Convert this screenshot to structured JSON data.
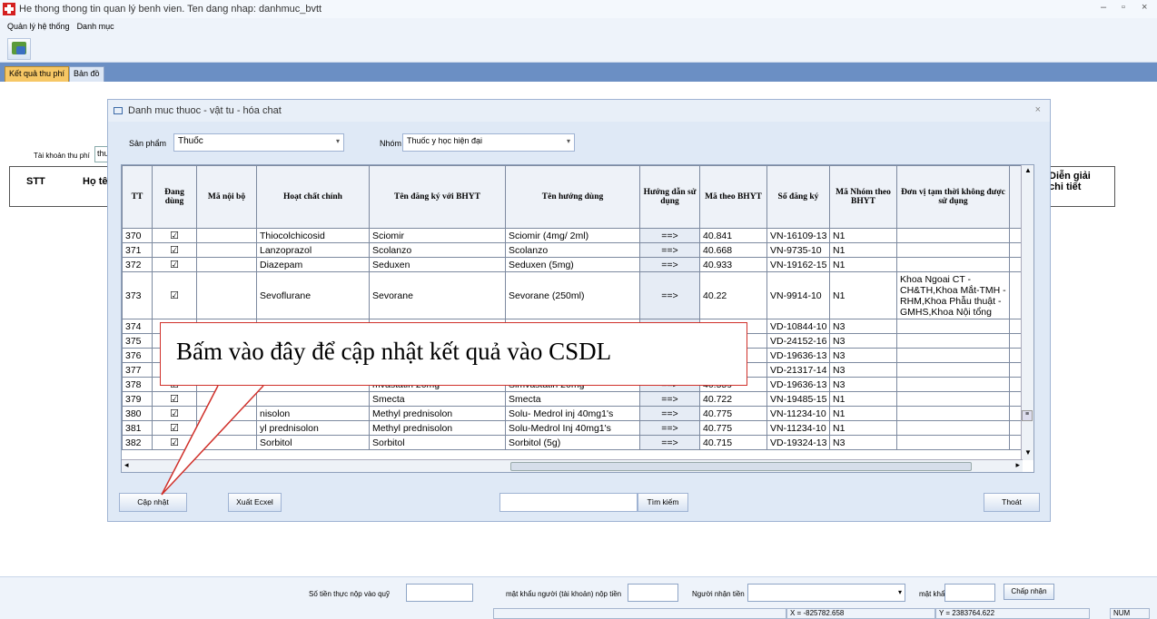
{
  "window": {
    "title": "He thong thong tin quan lý benh vien. Ten dang nhap: danhmuc_bvtt"
  },
  "menu": [
    "Quản lý hệ thống",
    "Danh mục"
  ],
  "tabs": {
    "active": "Kết quả thu phí",
    "inactive": "Bản đồ"
  },
  "background": {
    "account_label": "Tài khoản thu phí",
    "account_value": "thu",
    "header_stt": "STT",
    "header_ho_ten": "Họ tên",
    "header_dien_giai": "Diễn giải chi tiết"
  },
  "dialog": {
    "title": "Danh muc thuoc - vật tu - hóa chat",
    "product_label": "Sản phẩm",
    "product_value": "Thuốc",
    "group_label": "Nhóm",
    "group_value": "Thuốc y học hiện đại",
    "columns": [
      "TT",
      "Đang dùng",
      "Mã nội bộ",
      "Hoạt chất chính",
      "Tên đăng ký với BHYT",
      "Tên hướng dùng",
      "Hướng dẫn sử dụng",
      "Mã theo BHYT",
      "Số đăng ký",
      "Mã Nhóm theo BHYT",
      "Đơn vị tạm thời không được sử dụng"
    ],
    "rows": [
      {
        "tt": "370",
        "dang_dung": "☑",
        "hoat_chat": "Thiocolchicosid",
        "ten_dk": "Sciomir",
        "ten_hd": "Sciomir (4mg/ 2ml)",
        "hd": "==>",
        "ma_bhyt": "40.841",
        "so_dk": "VN-16109-13",
        "nhom": "N1",
        "don_vi": ""
      },
      {
        "tt": "371",
        "dang_dung": "☑",
        "hoat_chat": "Lanzoprazol",
        "ten_dk": "Scolanzo",
        "ten_hd": "Scolanzo",
        "hd": "==>",
        "ma_bhyt": "40.668",
        "so_dk": "VN-9735-10",
        "nhom": "N1",
        "don_vi": ""
      },
      {
        "tt": "372",
        "dang_dung": "☑",
        "hoat_chat": "Diazepam",
        "ten_dk": "Seduxen",
        "ten_hd": "Seduxen (5mg)",
        "hd": "==>",
        "ma_bhyt": "40.933",
        "so_dk": "VN-19162-15",
        "nhom": "N1",
        "don_vi": ""
      },
      {
        "tt": "373",
        "dang_dung": "☑",
        "hoat_chat": "Sevoflurane",
        "ten_dk": "Sevorane",
        "ten_hd": "Sevorane (250ml)",
        "hd": "==>",
        "ma_bhyt": "40.22",
        "so_dk": "VN-9914-10",
        "nhom": "N1",
        "don_vi": "Khoa Ngoai CT -CH&TH,Khoa Mắt-TMH -RHM,Khoa Phẫu thuật - GMHS,Khoa Nội tổng"
      },
      {
        "tt": "374",
        "dang_dung": "",
        "hoat_chat": "",
        "ten_dk": "",
        "ten_hd": "",
        "hd": "",
        "ma_bhyt": "",
        "so_dk": "VD-10844-10",
        "nhom": "N3",
        "don_vi": ""
      },
      {
        "tt": "375",
        "dang_dung": "",
        "hoat_chat": "",
        "ten_dk": "",
        "ten_hd": "",
        "hd": "",
        "ma_bhyt": "",
        "so_dk": "VD-24152-16",
        "nhom": "N3",
        "don_vi": ""
      },
      {
        "tt": "376",
        "dang_dung": "",
        "hoat_chat": "",
        "ten_dk": "",
        "ten_hd": "",
        "hd": "",
        "ma_bhyt": "",
        "so_dk": "VD-19636-13",
        "nhom": "N3",
        "don_vi": ""
      },
      {
        "tt": "377",
        "dang_dung": "",
        "hoat_chat": "",
        "ten_dk": "",
        "ten_hd": "",
        "hd": "",
        "ma_bhyt": "",
        "so_dk": "VD-21317-14",
        "nhom": "N3",
        "don_vi": ""
      },
      {
        "tt": "378",
        "dang_dung": "☑",
        "hoat_chat": "",
        "ten_dk": "mvastatin 20mg",
        "ten_hd": "Simvastatin 20mg",
        "hd": "==>",
        "ma_bhyt": "40.559",
        "so_dk": "VD-19636-13",
        "nhom": "N3",
        "don_vi": ""
      },
      {
        "tt": "379",
        "dang_dung": "☑",
        "hoat_chat": "",
        "ten_dk": "Smecta",
        "ten_hd": "Smecta",
        "hd": "==>",
        "ma_bhyt": "40.722",
        "so_dk": "VN-19485-15",
        "nhom": "N1",
        "don_vi": ""
      },
      {
        "tt": "380",
        "dang_dung": "☑",
        "hoat_chat": "nisolon",
        "ten_dk": "Methyl prednisolon",
        "ten_hd": "Solu- Medrol inj 40mg1's",
        "hd": "==>",
        "ma_bhyt": "40.775",
        "so_dk": "VN-11234-10",
        "nhom": "N1",
        "don_vi": ""
      },
      {
        "tt": "381",
        "dang_dung": "☑",
        "hoat_chat": "yl prednisolon",
        "ten_dk": "Methyl prednisolon",
        "ten_hd": "Solu-Medrol Inj 40mg1's",
        "hd": "==>",
        "ma_bhyt": "40.775",
        "so_dk": "VN-11234-10",
        "nhom": "N1",
        "don_vi": ""
      },
      {
        "tt": "382",
        "dang_dung": "☑",
        "hoat_chat": "Sorbitol",
        "ten_dk": "Sorbitol",
        "ten_hd": "Sorbitol (5g)",
        "hd": "==>",
        "ma_bhyt": "40.715",
        "so_dk": "VD-19324-13",
        "nhom": "N3",
        "don_vi": ""
      }
    ],
    "btn_update": "Cập nhật",
    "btn_export": "Xuất Ecxel",
    "btn_search": "Tìm kiếm",
    "btn_exit": "Thoát"
  },
  "callout": {
    "text": "Bấm vào đây để cập nhật kết quả vào CSDL",
    "color": "#d0302a"
  },
  "footer": {
    "amount_label": "Số tiền thực nộp vào quỹ",
    "password_payer_label": "mật khẩu người (tài khoản) nộp tiền",
    "receiver_label": "Người nhận tiền",
    "password_label": "mật khẩu",
    "accept_button": "Chấp nhận"
  },
  "status": {
    "x": "X = -825782.658",
    "y": "Y = 2383764.622",
    "num": "NUM"
  }
}
